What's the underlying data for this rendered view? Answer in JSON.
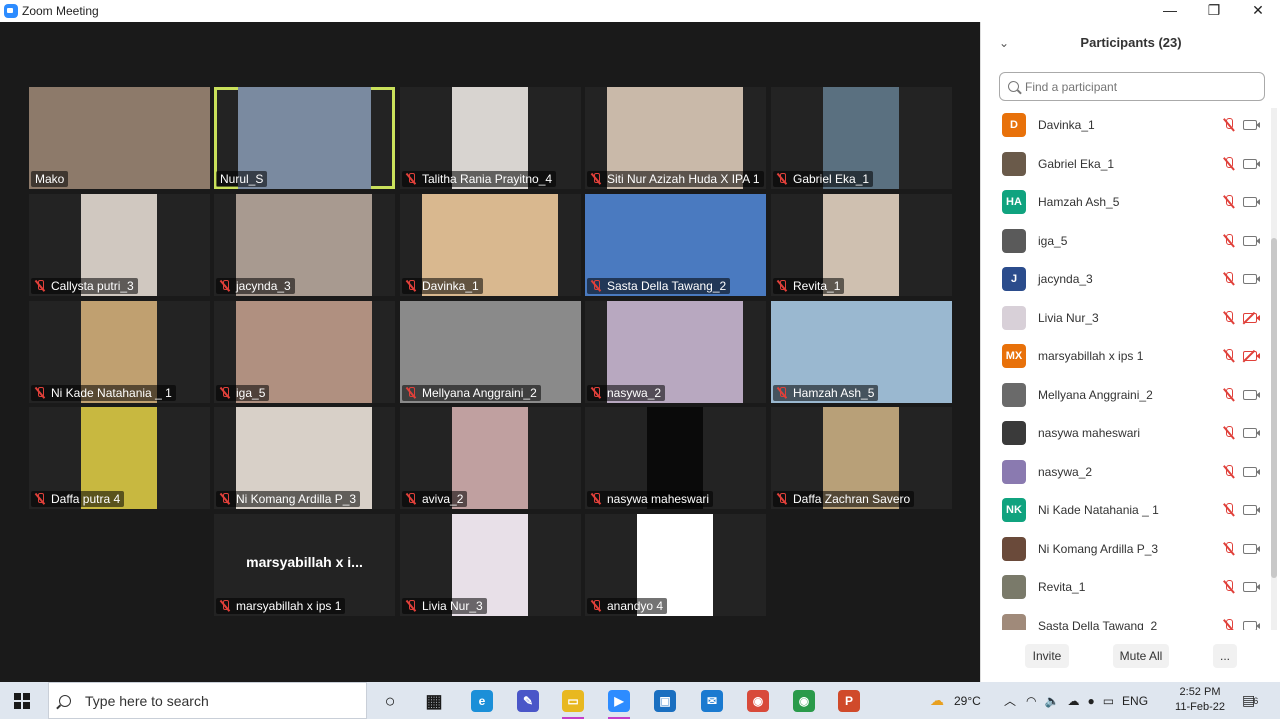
{
  "window": {
    "title": "Zoom Meeting"
  },
  "tiles": [
    {
      "name": "Mako",
      "muted": false,
      "bg": "#8d7a6a",
      "vx": 0,
      "vw": 181
    },
    {
      "name": "Nurul_S",
      "muted": false,
      "bg": "#7a8aa0",
      "vx": 24,
      "vw": 133
    },
    {
      "name": "Talitha Rania Prayitno_4",
      "muted": true,
      "bg": "#d8d4d0",
      "vx": 52,
      "vw": 76
    },
    {
      "name": "Siti Nur Azizah Huda X IPA 1",
      "muted": true,
      "bg": "#c9b9a9",
      "vx": 22,
      "vw": 136
    },
    {
      "name": "Gabriel Eka_1",
      "muted": true,
      "bg": "#5a7080",
      "vx": 52,
      "vw": 76
    },
    {
      "name": "Callysta putri_3",
      "muted": true,
      "bg": "#d0c8c0",
      "vx": 52,
      "vw": 76
    },
    {
      "name": "jacynda_3",
      "muted": true,
      "bg": "#a89a90",
      "vx": 22,
      "vw": 136
    },
    {
      "name": "Davinka_1",
      "muted": true,
      "bg": "#d9b88f",
      "vx": 22,
      "vw": 136
    },
    {
      "name": "Sasta Della Tawang_2",
      "muted": true,
      "bg": "#4a7ac0",
      "vx": 0,
      "vw": 181
    },
    {
      "name": "Revita_1",
      "muted": true,
      "bg": "#cfc0b0",
      "vx": 52,
      "vw": 76
    },
    {
      "name": "Ni Kade Natahania _ 1",
      "muted": true,
      "bg": "#c0a070",
      "vx": 52,
      "vw": 76
    },
    {
      "name": "iga_5",
      "muted": true,
      "bg": "#b09080",
      "vx": 22,
      "vw": 136
    },
    {
      "name": "Mellyana Anggraini_2",
      "muted": true,
      "bg": "#8a8a8a",
      "vx": 0,
      "vw": 181
    },
    {
      "name": "nasywa_2",
      "muted": true,
      "bg": "#b8a8c0",
      "vx": 22,
      "vw": 136
    },
    {
      "name": "Hamzah Ash_5",
      "muted": true,
      "bg": "#9ab8d0",
      "vx": 0,
      "vw": 181
    },
    {
      "name": "Daffa putra 4",
      "muted": true,
      "bg": "#c8b840",
      "vx": 52,
      "vw": 76
    },
    {
      "name": "Ni Komang Ardilla P_3",
      "muted": true,
      "bg": "#d8d0c8",
      "vx": 22,
      "vw": 136
    },
    {
      "name": "aviva_2",
      "muted": true,
      "bg": "#c0a0a0",
      "vx": 52,
      "vw": 76
    },
    {
      "name": "nasywa maheswari",
      "muted": true,
      "bg": "#0a0a0a",
      "vx": 62,
      "vw": 56
    },
    {
      "name": "Daffa Zachran Savero",
      "muted": true,
      "bg": "#b8a078",
      "vx": 52,
      "vw": 76
    },
    {
      "name": "marsyabillah x ips 1",
      "muted": true,
      "bg": "",
      "vx": 0,
      "vw": 0,
      "display": "marsyabillah x i..."
    },
    {
      "name": "Livia Nur_3",
      "muted": true,
      "bg": "#e8e0e8",
      "vx": 52,
      "vw": 76
    },
    {
      "name": "anandyo 4",
      "muted": true,
      "bg": "#ffffff",
      "vx": 52,
      "vw": 76
    }
  ],
  "participants_panel": {
    "title": "Participants (23)",
    "search_placeholder": "Find a participant",
    "participants": [
      {
        "name": "Davinka_1",
        "initials": "D",
        "color": "#e8710a",
        "cam_off": false
      },
      {
        "name": "Gabriel Eka_1",
        "initials": "",
        "color": "#6a5a4a",
        "cam_off": false
      },
      {
        "name": "Hamzah Ash_5",
        "initials": "HA",
        "color": "#10a37f",
        "cam_off": false
      },
      {
        "name": "iga_5",
        "initials": "",
        "color": "#5a5a5a",
        "cam_off": false
      },
      {
        "name": "jacynda_3",
        "initials": "J",
        "color": "#2b4c8c",
        "cam_off": false
      },
      {
        "name": "Livia Nur_3",
        "initials": "",
        "color": "#d8d0d8",
        "cam_off": true
      },
      {
        "name": "marsyabillah x ips 1",
        "initials": "MX",
        "color": "#e8710a",
        "cam_off": true
      },
      {
        "name": "Mellyana Anggraini_2",
        "initials": "",
        "color": "#6a6a6a",
        "cam_off": false
      },
      {
        "name": "nasywa maheswari",
        "initials": "",
        "color": "#3a3a3a",
        "cam_off": false
      },
      {
        "name": "nasywa_2",
        "initials": "",
        "color": "#8a7ab0",
        "cam_off": false
      },
      {
        "name": "Ni Kade Natahania _ 1",
        "initials": "NK",
        "color": "#10a37f",
        "cam_off": false
      },
      {
        "name": "Ni Komang Ardilla P_3",
        "initials": "",
        "color": "#6a4a3a",
        "cam_off": false
      },
      {
        "name": "Revita_1",
        "initials": "",
        "color": "#7a7a6a",
        "cam_off": false
      },
      {
        "name": "Sasta Della Tawang_2",
        "initials": "",
        "color": "#a08a7a",
        "cam_off": false
      }
    ],
    "invite_label": "Invite",
    "mute_all_label": "Mute All",
    "more_label": "..."
  },
  "taskbar": {
    "search_placeholder": "Type here to search",
    "weather": "29°C",
    "language": "ENG",
    "time": "2:52 PM",
    "date": "11-Feb-22",
    "notification_count": "6",
    "apps": [
      {
        "icon": "task-view-icon",
        "color": "#1a1a1a",
        "glyph": "○"
      },
      {
        "icon": "widgets-icon",
        "color": "#1a1a1a",
        "glyph": "▦"
      },
      {
        "icon": "edge-icon",
        "color": "#1b8fd8",
        "glyph": "e"
      },
      {
        "icon": "pen-app-icon",
        "color": "#4a56c8",
        "glyph": "✎"
      },
      {
        "icon": "file-explorer-icon",
        "color": "#e8b820",
        "glyph": "▭"
      },
      {
        "icon": "zoom-icon",
        "color": "#2d8cff",
        "glyph": "▶"
      },
      {
        "icon": "store-icon",
        "color": "#1a6fc0",
        "glyph": "▣"
      },
      {
        "icon": "mail-icon",
        "color": "#1a7ad0",
        "glyph": "✉"
      },
      {
        "icon": "chrome-icon",
        "color": "#d84a3a",
        "glyph": "◉"
      },
      {
        "icon": "chrome-profile-icon",
        "color": "#2a9a4a",
        "glyph": "◉"
      },
      {
        "icon": "powerpoint-icon",
        "color": "#d04a2a",
        "glyph": "P"
      }
    ]
  }
}
